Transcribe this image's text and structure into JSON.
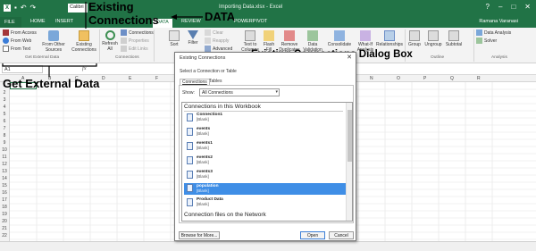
{
  "window": {
    "title": "Importing Data.xlsx - Excel",
    "font_name": "Calibri",
    "user": "Ramana Varanasi"
  },
  "tabs": [
    {
      "label": "FILE"
    },
    {
      "label": "HOME"
    },
    {
      "label": "INSERT"
    },
    {
      "label": "DATA"
    },
    {
      "label": "REVIEW"
    },
    {
      "label": "POWERPIVOT"
    }
  ],
  "ribbon": {
    "from_access": "From Access",
    "from_web": "From Web",
    "from_text": "From Text",
    "from_other_sources": "From Other Sources",
    "existing_connections_1": "Existing",
    "existing_connections_2": "Connections",
    "refresh_all": "Refresh All",
    "connections": "Connections",
    "properties": "Properties",
    "edit_links": "Edit Links",
    "sort": "Sort",
    "filter": "Filter",
    "clear": "Clear",
    "reapply": "Reapply",
    "advanced": "Advanced",
    "text_to_columns": "Text to Columns",
    "flash_fill": "Flash Fill",
    "remove_duplicates": "Remove Duplicates",
    "data_validation": "Data Validation",
    "consolidate": "Consolidate",
    "what_if": "What-If Analysis",
    "relationships": "Relationships",
    "group": "Group",
    "ungroup": "Ungroup",
    "subtotal": "Subtotal",
    "data_analysis": "Data Analysis",
    "solver": "Solver",
    "group_get_external_data": "Get External Data",
    "group_connections": "Connections",
    "group_outline": "Outline",
    "group_analysis": "Analysis"
  },
  "formula_bar": {
    "name_box": "A1",
    "fx": "fx"
  },
  "columns": [
    "A",
    "B",
    "C",
    "D",
    "E",
    "F",
    "G",
    "H",
    "I",
    "J",
    "K",
    "L",
    "M",
    "N",
    "O",
    "P",
    "Q",
    "R"
  ],
  "rows": [
    "1",
    "2",
    "3",
    "4",
    "5",
    "6",
    "7",
    "8",
    "9",
    "10",
    "11",
    "12",
    "13",
    "14",
    "15",
    "16",
    "17",
    "18",
    "19",
    "20",
    "21",
    "22"
  ],
  "annotations": {
    "existing_1": "Existing",
    "existing_2": "Connections",
    "data": "DATA",
    "dialog": "Existing Connections Dialog Box",
    "get_external": "Get External Data"
  },
  "dialog": {
    "title": "Existing Connections",
    "close": "✕",
    "prompt": "Select a Connection or Table",
    "tab_connections": "Connections",
    "tab_tables": "Tables",
    "show_label": "Show:",
    "show_value": "All Connections",
    "section_workbook": "Connections in this Workbook",
    "section_network": "Connection files on the Network",
    "items": [
      {
        "name": "Connection1",
        "desc": "[Blank]"
      },
      {
        "name": "events",
        "desc": "[Blank]"
      },
      {
        "name": "events1",
        "desc": "[Blank]"
      },
      {
        "name": "events2",
        "desc": "[Blank]"
      },
      {
        "name": "events3",
        "desc": "[Blank]"
      },
      {
        "name": "population",
        "desc": "[Blank]"
      },
      {
        "name": "Product Data",
        "desc": "[Blank]"
      }
    ],
    "selected_index": 5,
    "browse_button": "Browse for More...",
    "open_button": "Open",
    "cancel_button": "Cancel"
  },
  "colors": {
    "excel_green": "#217346",
    "selection_blue": "#3f8ee6"
  }
}
